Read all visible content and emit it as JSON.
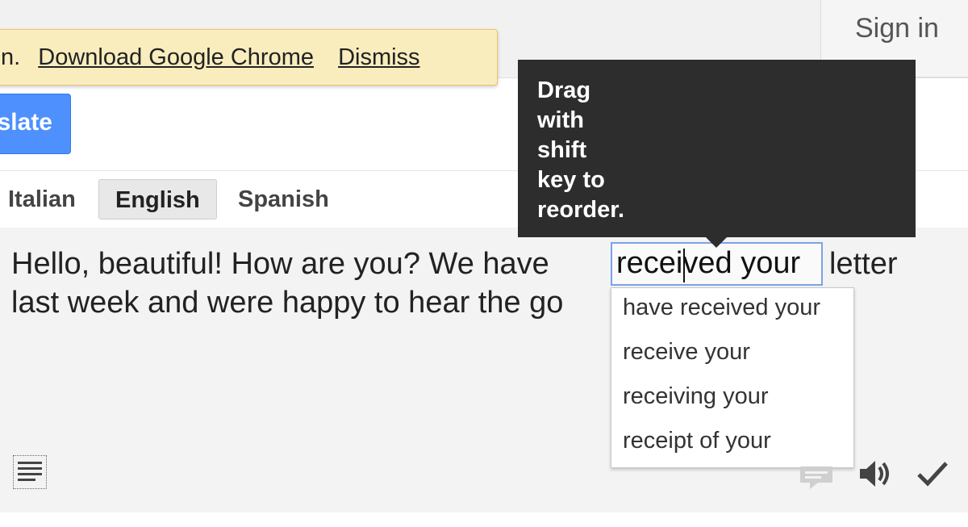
{
  "header": {
    "signin_label": "Sign in"
  },
  "notice": {
    "leading_text": "n.",
    "download_link": "Download Google Chrome",
    "dismiss_link": "Dismiss"
  },
  "toolbar": {
    "translate_label": "slate"
  },
  "languages": {
    "tabs": [
      "Italian",
      "English",
      "Spanish"
    ],
    "active": "English"
  },
  "source": {
    "line1_before": "Hello, beautiful! How are you? We have",
    "selected_phrase": "received your",
    "line1_after": "letter",
    "line2": "last week and were happy to hear the go"
  },
  "tooltip": {
    "lines": [
      "Drag",
      "with",
      "shift",
      "key to",
      "reorder."
    ]
  },
  "suggestions": [
    "have received your",
    "receive your",
    "receiving your",
    "receipt of your"
  ],
  "icons": {
    "document": "document-icon",
    "comment": "comment-icon",
    "speaker": "speaker-icon",
    "check": "check-icon"
  },
  "colors": {
    "notice_bg": "#f9edbe",
    "button_blue": "#4d90fe",
    "tooltip_bg": "#2d2d2d",
    "selection_border": "#7aa3e8"
  }
}
